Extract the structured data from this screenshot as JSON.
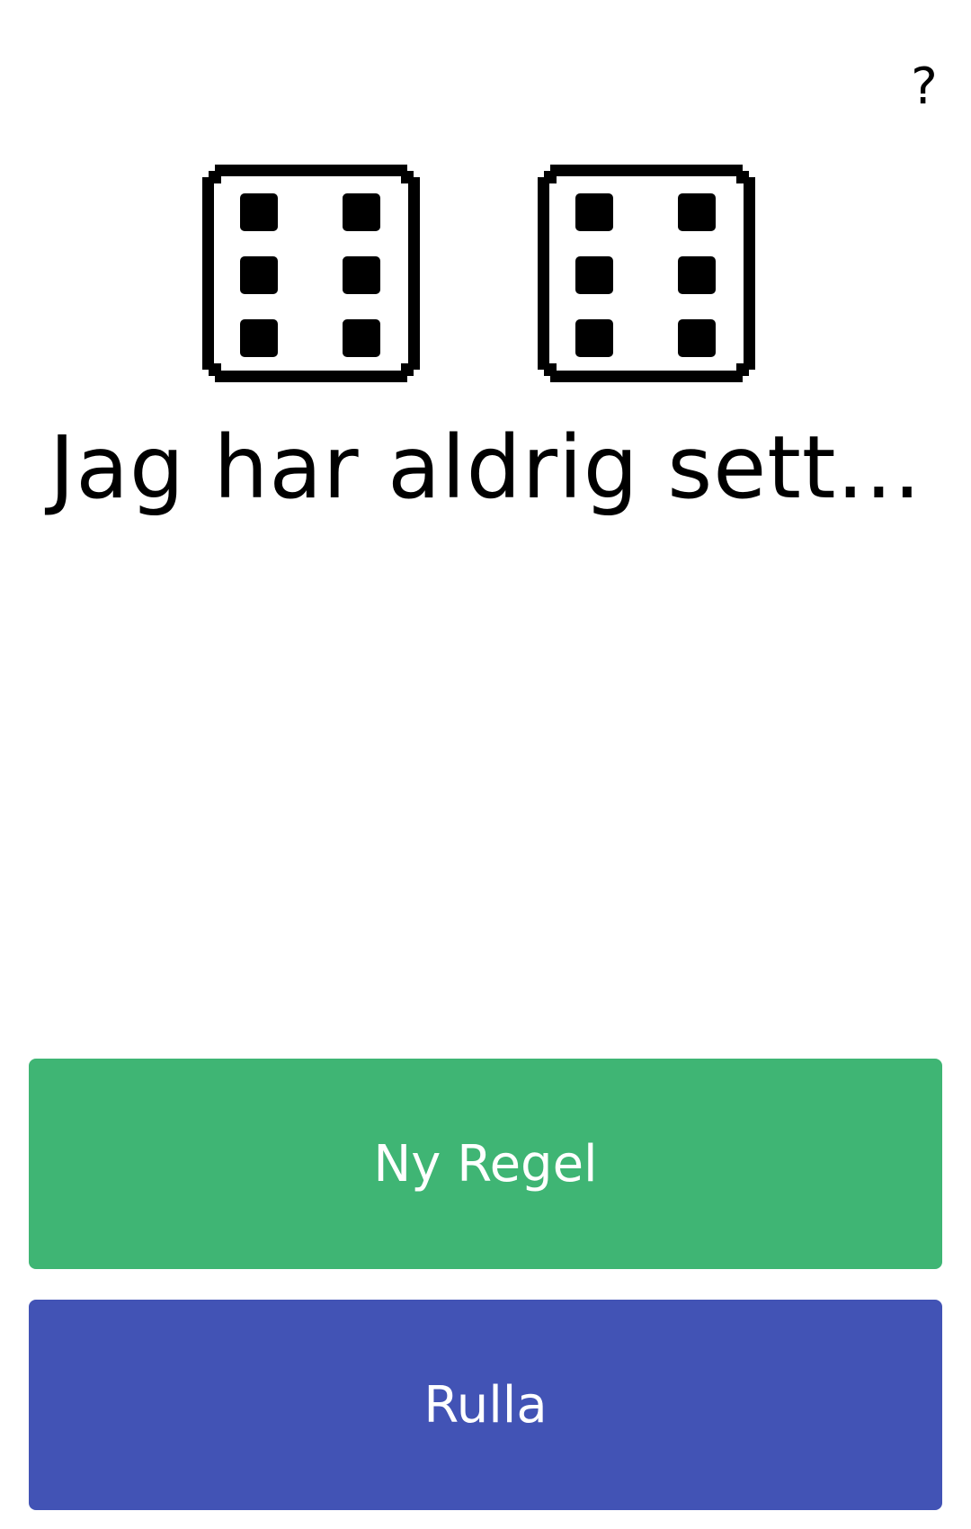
{
  "header": {
    "help_label": "?"
  },
  "dice": [
    {
      "face": 6
    },
    {
      "face": 6
    }
  ],
  "rule": {
    "text": "Jag har aldrig sett..."
  },
  "buttons": {
    "new_rule_label": "Ny Regel",
    "roll_label": "Rulla"
  },
  "colors": {
    "new_rule_bg": "#3fb574",
    "roll_bg": "#4253b5",
    "button_text": "#ffffff",
    "die_ink": "#000000"
  }
}
